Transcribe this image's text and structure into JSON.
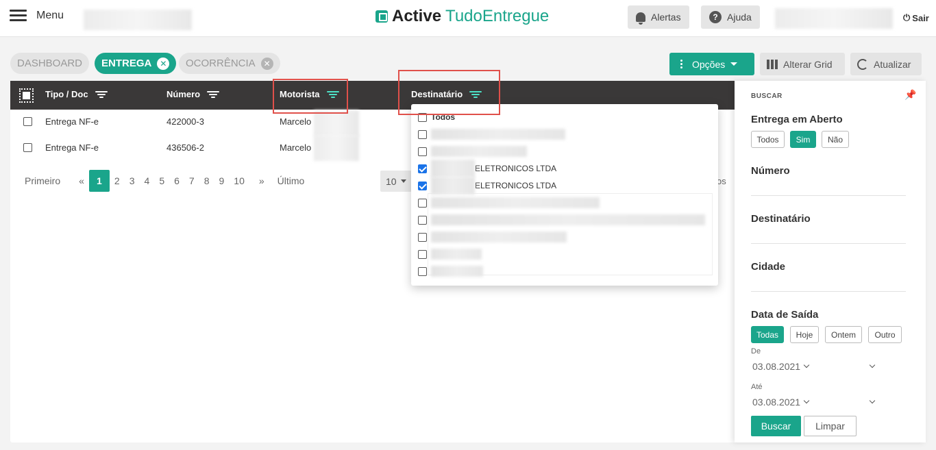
{
  "header": {
    "menu_label": "Menu",
    "brand_bold": "Active",
    "brand_light": "TudoEntregue",
    "alerts_label": "Alertas",
    "help_label": "Ajuda",
    "help_glyph": "?",
    "logout_glyph": "⏻",
    "logout_label": "Sair"
  },
  "tabs": [
    {
      "label": "DASHBOARD",
      "active": false
    },
    {
      "label": "ENTREGA",
      "active": true,
      "close": "✕"
    },
    {
      "label": "OCORRÊNCIA",
      "active": false,
      "close": "✕"
    }
  ],
  "toolbar": {
    "options_label": "Opções",
    "grid_label": "Alterar Grid",
    "refresh_label": "Atualizar"
  },
  "table": {
    "columns": [
      "Tipo / Doc",
      "Número",
      "Motorista",
      "Destinatário"
    ],
    "rows": [
      {
        "tipo": "Entrega NF-e",
        "numero": "422000-3",
        "motorista": "Marcelo"
      },
      {
        "tipo": "Entrega NF-e",
        "numero": "436506-2",
        "motorista": "Marcelo"
      }
    ]
  },
  "pagination": {
    "first": "Primeiro",
    "prev": "«",
    "pages": [
      "1",
      "2",
      "3",
      "4",
      "5",
      "6",
      "7",
      "8",
      "9",
      "10"
    ],
    "current": "1",
    "next": "»",
    "last": "Último",
    "per_page": "10",
    "trailing": "os"
  },
  "destinatario_filter": {
    "all_label": "Todos",
    "items": [
      {
        "label": "",
        "checked": false
      },
      {
        "label": "",
        "checked": false
      },
      {
        "label": "ELETRONICOS LTDA",
        "checked": true
      },
      {
        "label": "ELETRONICOS LTDA",
        "checked": true
      },
      {
        "label": "",
        "checked": false
      },
      {
        "label": "",
        "checked": false
      },
      {
        "label": "",
        "checked": false
      },
      {
        "label": "",
        "checked": false
      },
      {
        "label": "",
        "checked": false
      }
    ]
  },
  "search_panel": {
    "heading": "BUSCAR",
    "pin_glyph": "📌",
    "open_delivery": {
      "label": "Entrega em Aberto",
      "options": [
        "Todos",
        "Sim",
        "Não"
      ],
      "selected": "Sim"
    },
    "numero_label": "Número",
    "destinatario_label": "Destinatário",
    "cidade_label": "Cidade",
    "departure": {
      "label": "Data de Saída",
      "options": [
        "Todas",
        "Hoje",
        "Ontem",
        "Outro"
      ],
      "selected": "Todas"
    },
    "from_label": "De",
    "from_value": "03.08.2021",
    "to_label": "Até",
    "to_value": "03.08.2021",
    "search_button": "Buscar",
    "clear_button": "Limpar"
  },
  "colors": {
    "accent": "#1aa58b",
    "header_dark": "#3a3838",
    "highlight": "#e0504a"
  }
}
